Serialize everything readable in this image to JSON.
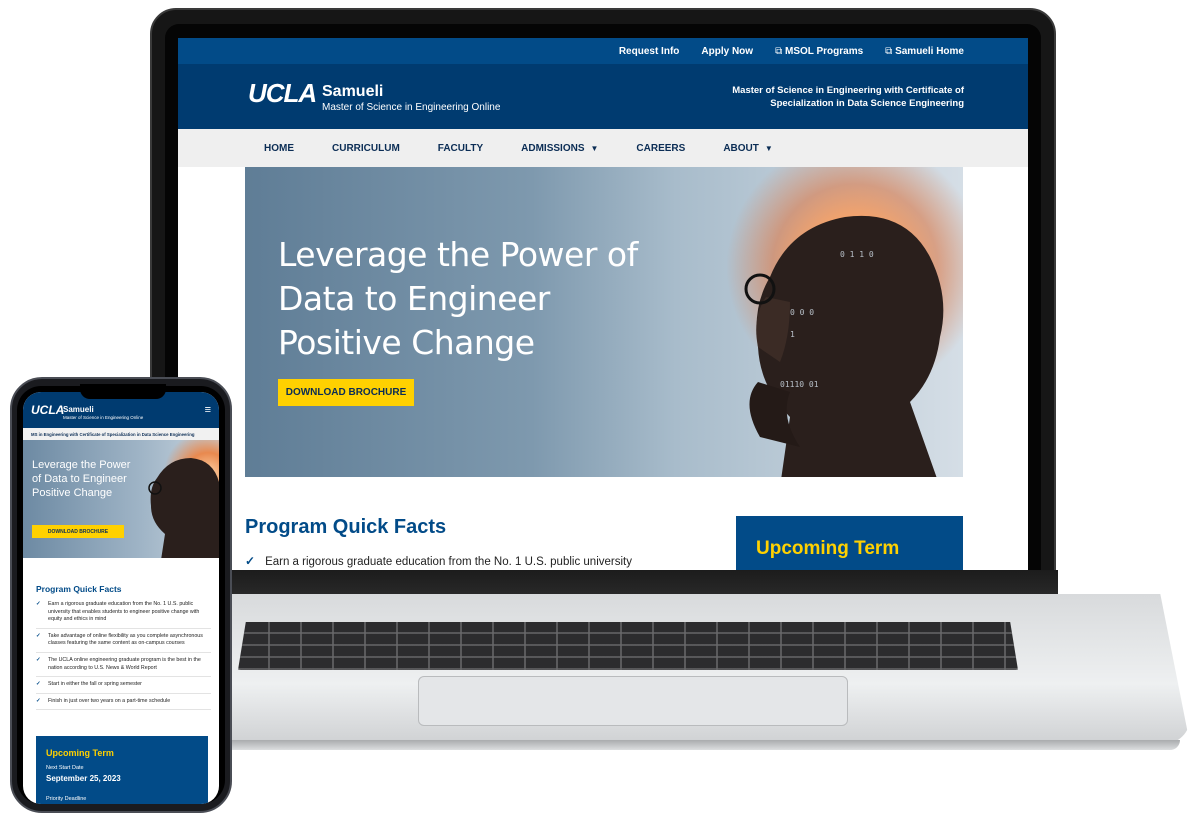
{
  "desktop": {
    "utility_nav": [
      "Request Info",
      "Apply Now",
      "MSOL Programs",
      "Samueli Home"
    ],
    "logo": {
      "ucla": "UCLA",
      "samueli": "Samueli",
      "subtitle": "Master of Science in Engineering Online"
    },
    "tagline": "Master of Science in Engineering with Certificate of Specialization in Data Science Engineering",
    "main_nav": [
      "HOME",
      "CURRICULUM",
      "FACULTY",
      "ADMISSIONS",
      "CAREERS",
      "ABOUT"
    ],
    "hero": {
      "title": "Leverage the Power of Data to Engineer Positive Change",
      "button": "DOWNLOAD BROCHURE"
    },
    "quick_facts_title": "Program Quick Facts",
    "first_fact": "Earn a rigorous graduate education from the No. 1 U.S. public university",
    "upcoming_term_title": "Upcoming Term"
  },
  "mobile": {
    "logo": {
      "ucla": "UCLA",
      "samueli": "Samueli",
      "subtitle": "Master of Science in Engineering Online"
    },
    "menu_icon": "hamburger-icon",
    "tagline": "MS in Engineering with Certificate of Specialization in Data Science Engineering",
    "hero": {
      "title": "Leverage the Power of Data to Engineer Positive Change",
      "button": "DOWNLOAD BROCHURE"
    },
    "quick_facts_title": "Program Quick Facts",
    "facts": [
      "Earn a rigorous graduate education from the No. 1 U.S. public university that enables students to engineer positive change with equity and ethics in mind",
      "Take advantage of online flexibility as you complete asynchronous classes featuring the same content as on-campus courses",
      "The UCLA online engineering graduate program is the best in the nation according to U.S. News & World Report",
      "Start in either the fall or spring semester",
      "Finish in just over two years on a part-time schedule"
    ],
    "upcoming_term": {
      "title": "Upcoming Term",
      "next_start_label": "Next Start Date",
      "next_start_date": "September 25, 2023",
      "priority_label": "Priority Deadline"
    }
  },
  "colors": {
    "navy": "#003b70",
    "blue": "#024b88",
    "gold": "#ffd100",
    "nav_bg": "#efefef"
  }
}
